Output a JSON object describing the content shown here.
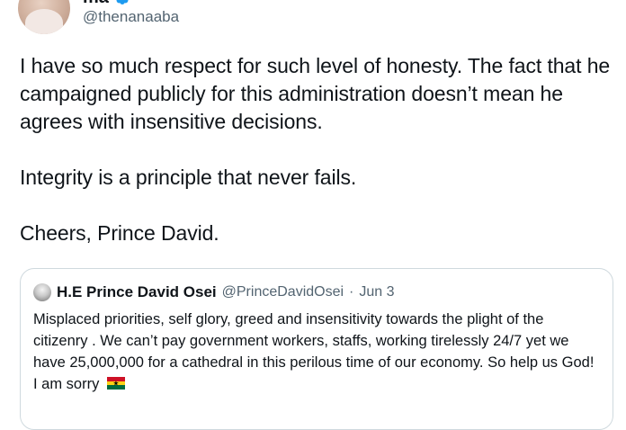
{
  "author": {
    "display_name": "ma",
    "handle": "@thenanaaba",
    "verified": true
  },
  "tweet": {
    "paragraphs": [
      "I have so much respect for such level of honesty. The fact that he campaigned publicly for this administration doesn’t mean he agrees with insensitive decisions.",
      "Integrity is a principle that never fails.",
      "Cheers, Prince David."
    ]
  },
  "quoted_tweet": {
    "display_name": "H.E Prince David Osei",
    "handle": "@PrinceDavidOsei",
    "separator": "·",
    "date": "Jun 3",
    "text": "Misplaced priorities, self glory, greed and insensitivity towards the plight of the citizenry . We can’t pay government workers, staffs, working tirelessly 24/7 yet we have 25,000,000 for a cathedral in this perilous time of our economy. So help us God! I am sorry",
    "emoji": "ghana-flag-icon"
  },
  "colors": {
    "text_primary": "#0f1419",
    "text_secondary": "#536471",
    "verified_blue": "#1d9bf0",
    "card_border": "#cfd9de"
  }
}
